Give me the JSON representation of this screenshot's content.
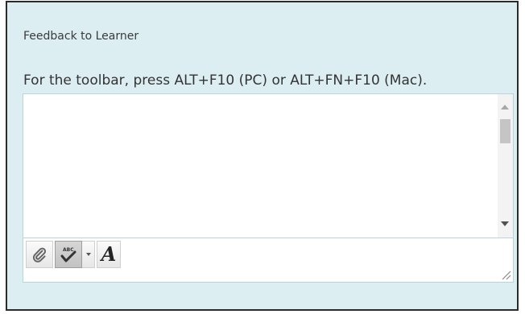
{
  "feedback": {
    "section_title": "Feedback to Learner",
    "instructions": "For the toolbar, press ALT+F10 (PC) or ALT+FN+F10 (Mac).",
    "text_value": "",
    "toolbar": {
      "attach_icon": "paperclip-icon",
      "spellcheck_icon": "spellcheck-icon",
      "spellcheck_dropdown_icon": "chevron-down-icon",
      "format_icon": "font-format-icon",
      "format_letter": "A"
    }
  }
}
